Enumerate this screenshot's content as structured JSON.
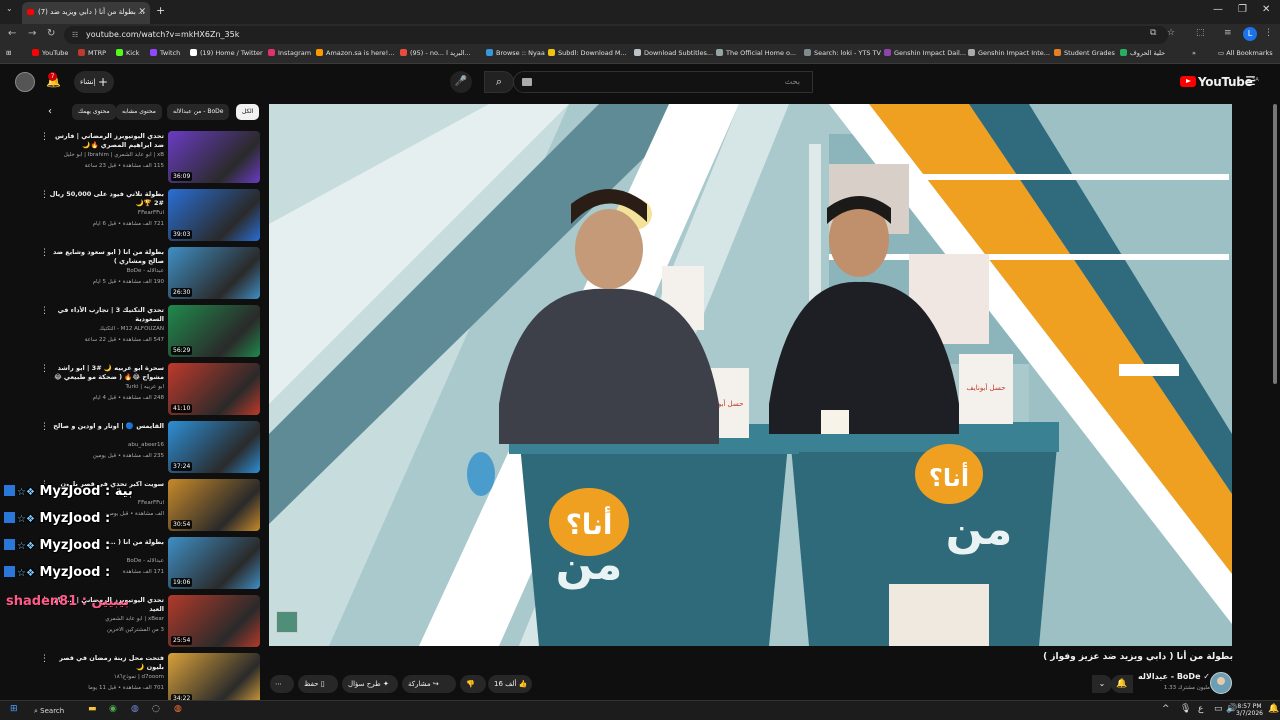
{
  "browser": {
    "tab_title": "(7) بطولة من أنا ( دابي ويزيد ضد ...",
    "tab_close": "✕",
    "new_tab": "+",
    "url": "youtube.com/watch?v=mkHX6Zn_35k",
    "bookmarks": [
      {
        "label": "YouTube",
        "color": "#ff0000"
      },
      {
        "label": "MTRP",
        "color": "#c0392b"
      },
      {
        "label": "Kick",
        "color": "#53fc18"
      },
      {
        "label": "Twitch",
        "color": "#9146ff"
      },
      {
        "label": "(19) Home / Twitter",
        "color": "#ffffff"
      },
      {
        "label": "Instagram",
        "color": "#e1306c"
      },
      {
        "label": "Amazon.sa is here!...",
        "color": "#ff9900"
      },
      {
        "label": "(95) - no... البريد ا...",
        "color": "#e74c3c"
      },
      {
        "label": "Browse :: Nyaa",
        "color": "#3498db"
      },
      {
        "label": "Subdl: Download M...",
        "color": "#f1c40f"
      },
      {
        "label": "Download Subtitles...",
        "color": "#bdc3c7"
      },
      {
        "label": "The Official Home o...",
        "color": "#95a5a6"
      },
      {
        "label": "Search: loki - YTS TV",
        "color": "#7f8c8d"
      },
      {
        "label": "Genshin Impact Dail...",
        "color": "#8e44ad"
      },
      {
        "label": "Genshin Impact Inte...",
        "color": "#aaaaaa"
      },
      {
        "label": "Student Grades",
        "color": "#e67e22"
      },
      {
        "label": "حلية الحروف",
        "color": "#27ae60"
      }
    ],
    "all_bookmarks": "All Bookmarks",
    "profile_initial": "L"
  },
  "youtube": {
    "logo_text": "YouTube",
    "region": "SA",
    "search_placeholder": "بحث",
    "create_label": "إنشاء",
    "notification_count": "7"
  },
  "chips": [
    {
      "label": "الكل",
      "active": true
    },
    {
      "label": "من عبدالاله - BoDe",
      "active": false
    },
    {
      "label": "محتوى مشابه",
      "active": false
    },
    {
      "label": "محتوى يهمك",
      "active": false
    }
  ],
  "recommendations": [
    {
      "title": "تحدي اليوتيوبرز الرمضاني | فارس ضد ابراهيم المصري 🔥🌙",
      "channel": "xB | ابو عابد الشمري | Ibrahim | ابو خليل",
      "meta": "115 ألف مشاهدة • قبل 23 ساعة",
      "duration": "36:09",
      "color": "#6a3cc4"
    },
    {
      "title": "بطولة تلاتي فيود على 50,000 ريال #2 🏆🌙",
      "channel": "FFearFFul",
      "meta": "721 ألف مشاهدة • قبل 6 أيام",
      "duration": "39:03",
      "color": "#2a6fd6"
    },
    {
      "title": "بطولة من انا ( ابو سعود وشايع ضد صالح ومشاري )",
      "channel": "عبدالاله - BoDe",
      "meta": "190 ألف مشاهدة • قبل 5 أيام",
      "duration": "26:30",
      "color": "#3f8fc5"
    },
    {
      "title": "تحدي التكتيك 3 | تجارب الأداء في السعودية",
      "channel": "M12 ALFOUZAN - التكتيك",
      "meta": "547 ألف مشاهدة • قبل 22 ساعة",
      "duration": "56:29",
      "color": "#1f8a4c"
    },
    {
      "title": "سحرة ابو عربيه 🌙 #3 | ابو راشد مشواح 😂🔥 ( ضحكة مو طبيعي 😂🔥 )",
      "channel": "ابو عربيه | Turki",
      "meta": "248 ألف مشاهدة • قبل 4 أيام",
      "duration": "41:10",
      "color": "#c0392b"
    },
    {
      "title": "القايمس 🔵 | اوتار و اودين و صالح",
      "channel": "abu_abeer16",
      "meta": "235 ألف مشاهدة • قبل يومين",
      "duration": "37:24",
      "color": "#2c8fd6"
    },
    {
      "title": "سويت اكبر تحدي في قصر بليون",
      "channel": "FFearFFul",
      "meta": "ألف مشاهدة • قبل يومين",
      "duration": "30:54",
      "color": "#c88a2a"
    },
    {
      "title": "بطولة من انا ( ...",
      "channel": "عبدالاله - BoDe",
      "meta": "171 ألف مشاهدة",
      "duration": "19:06",
      "color": "#3f8fc5"
    },
    {
      "title": "تحدي اليوتيوبرز الرمضاني | ... على العيد",
      "channel": "xBear | ابو عابد الشمري",
      "meta": "3 من المشتركين الآخرين",
      "duration": "25:54",
      "color": "#b23a2a"
    },
    {
      "title": "فتحت محل زينة رمضان في قصر بليون 🌙",
      "channel": "d7ooom | نموذج١٨٦",
      "meta": "701 ألف مشاهدة • قبل 11 يوماً",
      "duration": "34:22",
      "color": "#d9a13a"
    }
  ],
  "chat_overlay": [
    {
      "user": "MyzJood :",
      "text": "بية"
    },
    {
      "user": "MyzJood :",
      "text": ""
    },
    {
      "user": "MyzJood :",
      "text": ""
    },
    {
      "user": "MyzJood :",
      "text": ""
    }
  ],
  "chat_shaden": "shaden81 : بيبيين",
  "video": {
    "title": "بطولة من أنا ( دابي ويزيد ضد عزيز وفواز )",
    "channel": "عبدالاله - BoDe",
    "subscribers": "1.33 مليون مشترك",
    "likes": "16 ألف",
    "share": "مشاركة",
    "ask": "طرح سؤال",
    "save": "حفظ",
    "podium_brand": "حسل أبونايف",
    "podium_logo": "أنا؟",
    "podium_logo2": "من"
  },
  "taskbar": {
    "search": "Search",
    "time": "8:57 PM",
    "date": "3/7/2026"
  }
}
